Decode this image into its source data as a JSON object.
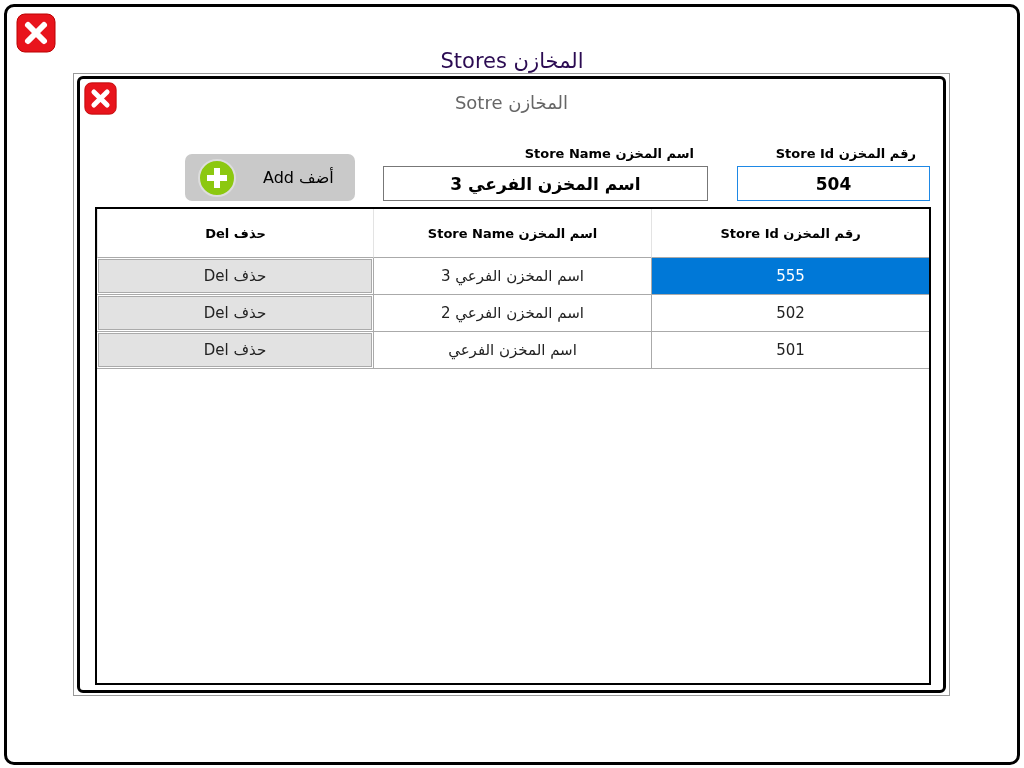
{
  "window": {
    "title": "المخازن Stores"
  },
  "dialog": {
    "title": "المخازن Sotre",
    "fields": [
      {
        "label": "رقم المخزن Store Id",
        "value": "504",
        "focused": true
      },
      {
        "label": "اسم المخزن Store Name",
        "value": "اسم المخزن الفرعي 3",
        "focused": false
      }
    ],
    "add_button": "أضف Add"
  },
  "table": {
    "columns": [
      "رقم المخزن Store Id",
      "اسم المخزن Store Name",
      "حذف Del"
    ],
    "rows": [
      {
        "store_id": "555",
        "store_name": "اسم المخزن الفرعي 3",
        "delete": "حذف Del",
        "selected": true
      },
      {
        "store_id": "502",
        "store_name": "اسم المخزن الفرعي 2",
        "delete": "حذف Del",
        "selected": false
      },
      {
        "store_id": "501",
        "store_name": "اسم المخزن الفرعي",
        "delete": "حذف Del",
        "selected": false
      }
    ]
  }
}
